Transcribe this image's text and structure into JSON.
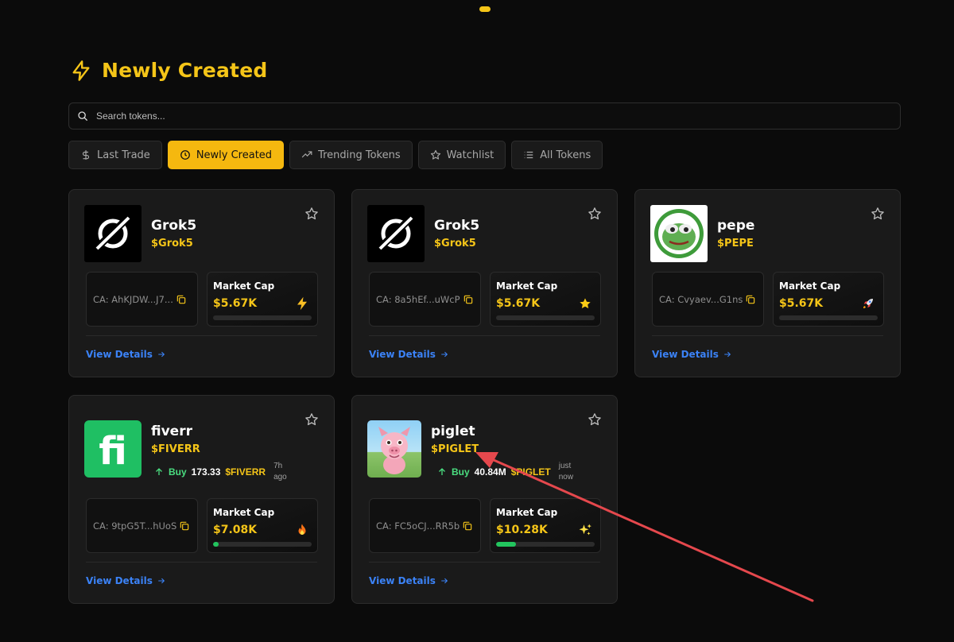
{
  "header": {
    "title": "Newly Created"
  },
  "search": {
    "placeholder": "Search tokens..."
  },
  "tabs": [
    {
      "label": "Last Trade",
      "icon": "dollar-icon",
      "active": false
    },
    {
      "label": "Newly Created",
      "icon": "clock-icon",
      "active": true
    },
    {
      "label": "Trending Tokens",
      "icon": "trending-icon",
      "active": false
    },
    {
      "label": "Watchlist",
      "icon": "star-icon",
      "active": false
    },
    {
      "label": "All Tokens",
      "icon": "list-icon",
      "active": false
    }
  ],
  "common": {
    "market_cap_label": "Market Cap",
    "view_details": "View Details"
  },
  "cards": [
    {
      "name": "Grok5",
      "ticker": "$Grok5",
      "ca": "CA: AhKJDW...J7...",
      "market_cap": "$5.67K",
      "progress": 0,
      "emoji": "lightning-icon",
      "logo": "grok-logo"
    },
    {
      "name": "Grok5",
      "ticker": "$Grok5",
      "ca": "CA: 8a5hEf...uWcP",
      "market_cap": "$5.67K",
      "progress": 0,
      "emoji": "star-emoji-icon",
      "logo": "grok-logo"
    },
    {
      "name": "pepe",
      "ticker": "$PEPE",
      "ca": "CA: Cvyaev...G1ns",
      "market_cap": "$5.67K",
      "progress": 0,
      "emoji": "rocket-icon",
      "logo": "pepe-logo"
    },
    {
      "name": "fiverr",
      "ticker": "$FIVERR",
      "ca": "CA: 9tpG5T...hUoS",
      "market_cap": "$7.08K",
      "progress": 0.06,
      "emoji": "fire-icon",
      "logo": "fiverr-logo",
      "trade": {
        "action": "Buy",
        "amount": "173.33",
        "symbol": "$FIVERR",
        "ago_line1": "7h",
        "ago_line2": "ago"
      }
    },
    {
      "name": "piglet",
      "ticker": "$PIGLET",
      "ca": "CA: FC5oCJ...RR5b",
      "market_cap": "$10.28K",
      "progress": 0.2,
      "emoji": "sparkles-icon",
      "logo": "piglet-logo",
      "trade": {
        "action": "Buy",
        "amount": "40.84M",
        "symbol": "$PIGLET",
        "ago_line1": "just",
        "ago_line2": "now"
      }
    }
  ],
  "colors": {
    "accent": "#f5c518",
    "tab_active": "#f5b80f",
    "link": "#3b82f6",
    "buy": "#4ade80",
    "annotation_arrow": "#e5484d"
  }
}
